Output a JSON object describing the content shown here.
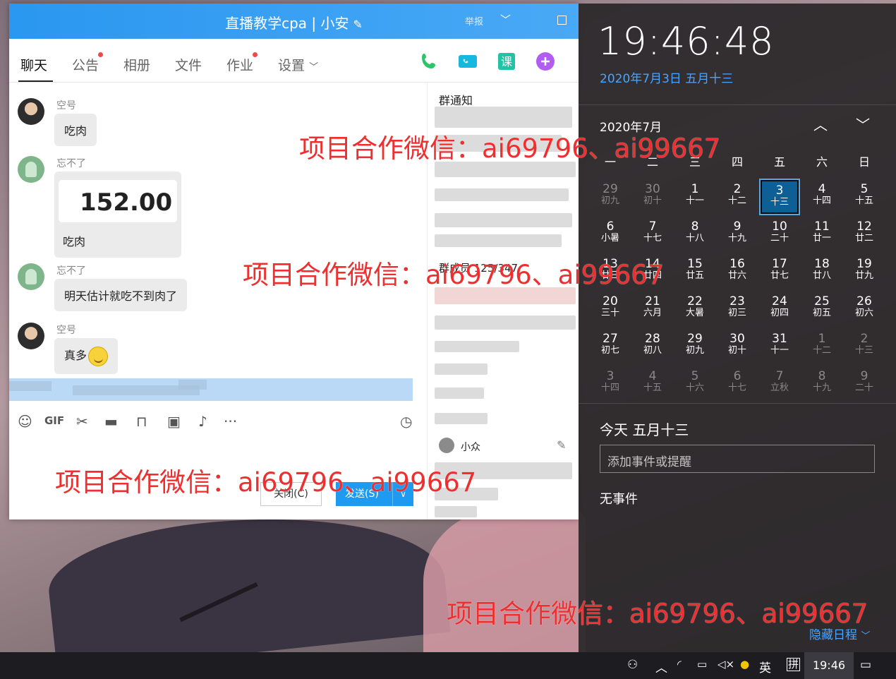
{
  "window": {
    "title": "直播教学cpa | 小安",
    "report_label": "举报"
  },
  "tabs": [
    {
      "label": "聊天"
    },
    {
      "label": "公告"
    },
    {
      "label": "相册"
    },
    {
      "label": "文件"
    },
    {
      "label": "作业"
    },
    {
      "label": "设置"
    }
  ],
  "messages": [
    {
      "sender": "空号",
      "text": "吃肉"
    },
    {
      "sender": "忘不了",
      "amount": "152.00",
      "text": "吃肉"
    },
    {
      "sender": "忘不了",
      "text": "明天估计就吃不到肉了"
    },
    {
      "sender": "空号",
      "text": "真多"
    }
  ],
  "composer": {
    "close_label": "关闭(C)",
    "send_label": "发送(S)"
  },
  "side": {
    "notice_title": "群通知",
    "members_title": "群成员 125/347",
    "member_name": "小众"
  },
  "action_center": {
    "time": "19:46:48",
    "date": "2020年7月3日 五月十三",
    "month": "2020年7月",
    "weekdays": [
      "一",
      "二",
      "三",
      "四",
      "五",
      "六",
      "日"
    ],
    "days": [
      {
        "d": "29",
        "l": "初九",
        "dim": true
      },
      {
        "d": "30",
        "l": "初十",
        "dim": true
      },
      {
        "d": "1",
        "l": "十一"
      },
      {
        "d": "2",
        "l": "十二"
      },
      {
        "d": "3",
        "l": "十三",
        "today": true
      },
      {
        "d": "4",
        "l": "十四"
      },
      {
        "d": "5",
        "l": "十五"
      },
      {
        "d": "6",
        "l": "小暑"
      },
      {
        "d": "7",
        "l": "十七"
      },
      {
        "d": "8",
        "l": "十八"
      },
      {
        "d": "9",
        "l": "十九"
      },
      {
        "d": "10",
        "l": "二十"
      },
      {
        "d": "11",
        "l": "廿一"
      },
      {
        "d": "12",
        "l": "廿二"
      },
      {
        "d": "13",
        "l": "廿三"
      },
      {
        "d": "14",
        "l": "廿四"
      },
      {
        "d": "15",
        "l": "廿五"
      },
      {
        "d": "16",
        "l": "廿六"
      },
      {
        "d": "17",
        "l": "廿七"
      },
      {
        "d": "18",
        "l": "廿八"
      },
      {
        "d": "19",
        "l": "廿九"
      },
      {
        "d": "20",
        "l": "三十"
      },
      {
        "d": "21",
        "l": "六月"
      },
      {
        "d": "22",
        "l": "大暑"
      },
      {
        "d": "23",
        "l": "初三"
      },
      {
        "d": "24",
        "l": "初四"
      },
      {
        "d": "25",
        "l": "初五"
      },
      {
        "d": "26",
        "l": "初六"
      },
      {
        "d": "27",
        "l": "初七"
      },
      {
        "d": "28",
        "l": "初八"
      },
      {
        "d": "29",
        "l": "初九"
      },
      {
        "d": "30",
        "l": "初十"
      },
      {
        "d": "31",
        "l": "十一"
      },
      {
        "d": "1",
        "l": "十二",
        "dim": true
      },
      {
        "d": "2",
        "l": "十三",
        "dim": true
      },
      {
        "d": "3",
        "l": "十四",
        "dim": true
      },
      {
        "d": "4",
        "l": "十五",
        "dim": true
      },
      {
        "d": "5",
        "l": "十六",
        "dim": true
      },
      {
        "d": "6",
        "l": "十七",
        "dim": true
      },
      {
        "d": "7",
        "l": "立秋",
        "dim": true
      },
      {
        "d": "8",
        "l": "十九",
        "dim": true
      },
      {
        "d": "9",
        "l": "二十",
        "dim": true
      }
    ],
    "today_heading": "今天 五月十三",
    "event_placeholder": "添加事件或提醒",
    "no_events": "无事件",
    "hide_schedule": "隐藏日程"
  },
  "taskbar": {
    "ime_lang": "英",
    "ime_mode": "拼",
    "time": "19:46"
  },
  "watermark": "项目合作微信：ai69796、ai99667",
  "colors": {
    "accent": "#1e9bf0",
    "calendar_today": "#0e5f95",
    "watermark": "#ef2f2f"
  }
}
